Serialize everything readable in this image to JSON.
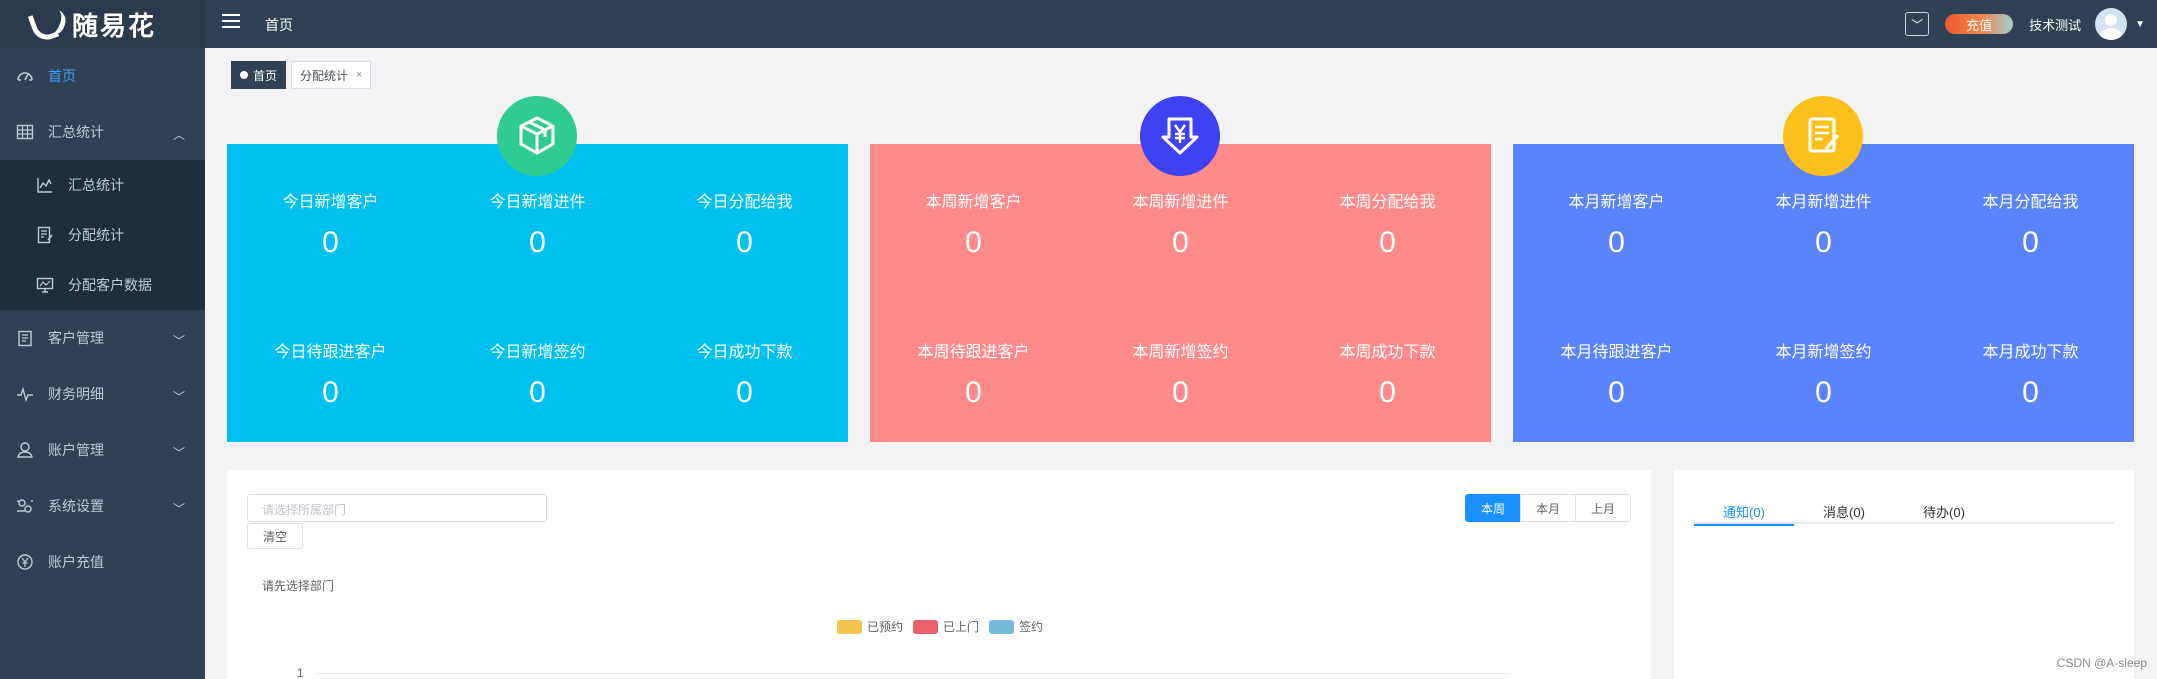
{
  "app": {
    "logo_text": "随易花"
  },
  "sidebar": {
    "items": [
      {
        "label": "首页",
        "icon": "dashboard-icon"
      },
      {
        "label": "汇总统计",
        "icon": "table-icon",
        "children": [
          {
            "label": "汇总统计",
            "icon": "line-chart-icon"
          },
          {
            "label": "分配统计",
            "icon": "edit-doc-icon"
          },
          {
            "label": "分配客户数据",
            "icon": "monitor-icon"
          }
        ]
      },
      {
        "label": "客户管理",
        "icon": "clipboard-icon"
      },
      {
        "label": "财务明细",
        "icon": "pulse-icon"
      },
      {
        "label": "账户管理",
        "icon": "user-icon"
      },
      {
        "label": "系统设置",
        "icon": "settings-icon"
      },
      {
        "label": "账户充值",
        "icon": "coin-icon"
      }
    ]
  },
  "header": {
    "breadcrumb": "首页",
    "recharge_label": "充值",
    "username": "技术测试"
  },
  "tags": {
    "home": "首页",
    "current": "分配统计",
    "close": "×"
  },
  "cards": [
    {
      "color": "#00c0ef",
      "badge_color": "#2fcb90",
      "icon": "box-icon",
      "stats": [
        {
          "label": "今日新增客户",
          "value": "0"
        },
        {
          "label": "今日新增进件",
          "value": "0"
        },
        {
          "label": "今日分配给我",
          "value": "0"
        },
        {
          "label": "今日待跟进客户",
          "value": "0"
        },
        {
          "label": "今日新增签约",
          "value": "0"
        },
        {
          "label": "今日成功下款",
          "value": "0"
        }
      ]
    },
    {
      "color": "#ff8a8a",
      "badge_color": "#3f42f2",
      "icon": "yen-down-icon",
      "stats": [
        {
          "label": "本周新增客户",
          "value": "0"
        },
        {
          "label": "本周新增进件",
          "value": "0"
        },
        {
          "label": "本周分配给我",
          "value": "0"
        },
        {
          "label": "本周待跟进客户",
          "value": "0"
        },
        {
          "label": "本周新增签约",
          "value": "0"
        },
        {
          "label": "本周成功下款",
          "value": "0"
        }
      ]
    },
    {
      "color": "#5a84fc",
      "badge_color": "#fcc01c",
      "icon": "note-icon",
      "stats": [
        {
          "label": "本月新增客户",
          "value": "0"
        },
        {
          "label": "本月新增进件",
          "value": "0"
        },
        {
          "label": "本月分配给我",
          "value": "0"
        },
        {
          "label": "本月待跟进客户",
          "value": "0"
        },
        {
          "label": "本月新增签约",
          "value": "0"
        },
        {
          "label": "本月成功下款",
          "value": "0"
        }
      ]
    }
  ],
  "chart_panel": {
    "dept_placeholder": "请选择所属部门",
    "clear_label": "清空",
    "periods": [
      "本周",
      "本月",
      "上月"
    ],
    "selected_period": "本周",
    "hint": "请先选择部门",
    "legend": [
      {
        "name": "已预约",
        "color": "#f5c34f"
      },
      {
        "name": "已上门",
        "color": "#e8606a"
      },
      {
        "name": "签约",
        "color": "#76bad9"
      }
    ],
    "y_tick": "1"
  },
  "notice_panel": {
    "tabs": [
      "通知(0)",
      "消息(0)",
      "待办(0)"
    ],
    "selected": 0
  },
  "watermark": "CSDN @A-sleep"
}
